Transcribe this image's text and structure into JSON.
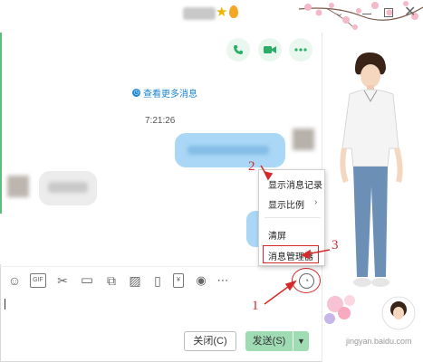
{
  "app": {
    "star_glyph": "★",
    "close_glyph": "✕",
    "chevron_glyph": "⌄"
  },
  "header_actions": [
    {
      "name": "phone-call-button",
      "icon": "phone-icon",
      "glyph": "✆"
    },
    {
      "name": "video-call-button",
      "icon": "video-icon",
      "glyph": "▶"
    },
    {
      "name": "more-button",
      "icon": "more-icon",
      "glyph": "•••"
    }
  ],
  "chat": {
    "more_messages": "查看更多消息",
    "timestamp": "7:21:26"
  },
  "toolbar": {
    "items": [
      {
        "name": "emoji-icon",
        "glyph": "☺"
      },
      {
        "name": "gif-icon",
        "glyph": "GIF"
      },
      {
        "name": "scissors-icon",
        "glyph": "✂"
      },
      {
        "name": "folder-icon",
        "glyph": "▭"
      },
      {
        "name": "multi-file-icon",
        "glyph": "⧉"
      },
      {
        "name": "image-icon",
        "glyph": "▨"
      },
      {
        "name": "shake-icon",
        "glyph": "▯"
      },
      {
        "name": "red-packet-icon",
        "glyph": "¥"
      },
      {
        "name": "voice-icon",
        "glyph": "◉"
      },
      {
        "name": "more-tools-icon",
        "glyph": "⋯"
      }
    ],
    "history_glyph": "◔"
  },
  "context_menu": {
    "items": [
      "显示消息记录",
      "显示比例",
      "清屏",
      "消息管理器"
    ],
    "submenu_arrow": "›"
  },
  "actions": {
    "close_label": "关闭(C)",
    "send_label": "发送(S)",
    "send_arrow": "▼"
  },
  "annotations": {
    "one": "1",
    "two": "2",
    "three": "3"
  },
  "watermark": "jingyan.baidu.com",
  "colors": {
    "accent": "#2aae67",
    "link": "#1a85d6",
    "annotation": "#d42a2a"
  }
}
